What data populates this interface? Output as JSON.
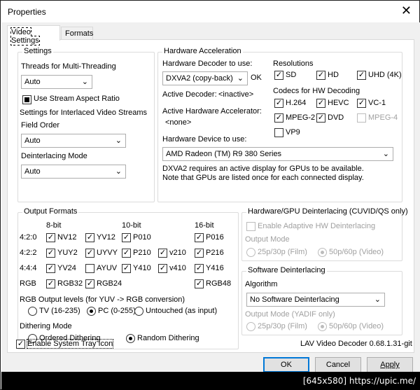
{
  "window": {
    "title": "Properties"
  },
  "tabs": [
    "Video Settings",
    "Formats"
  ],
  "settings": {
    "group_label": "Settings",
    "threads_label": "Threads for Multi-Threading",
    "threads_value": "Auto",
    "stream_aspect_label": "Use Stream Aspect Ratio",
    "interlaced_label": "Settings for Interlaced Video Streams",
    "field_order_label": "Field Order",
    "field_order_value": "Auto",
    "deint_mode_label": "Deinterlacing Mode",
    "deint_mode_value": "Auto"
  },
  "hwaccel": {
    "group_label": "Hardware Acceleration",
    "decoder_label": "Hardware Decoder to use:",
    "decoder_value": "DXVA2 (copy-back)",
    "ok_status": "OK",
    "active_decoder_label": "Active Decoder:",
    "active_decoder_value": "<inactive>",
    "active_accel_label": "Active Hardware Accelerator:",
    "active_accel_value": "<none>",
    "device_label": "Hardware Device to use:",
    "device_value": "AMD Radeon (TM) R9 380 Series",
    "note_line1": "DXVA2 requires an active display for GPUs to be available.",
    "note_line2": "Note that GPUs are listed once for each connected display.",
    "resolutions_label": "Resolutions",
    "res": [
      "SD",
      "HD",
      "UHD (4K)"
    ],
    "codecs_label": "Codecs for HW Decoding",
    "codecs": [
      "H.264",
      "HEVC",
      "VC-1",
      "MPEG-2",
      "DVD",
      "MPEG-4",
      "VP9"
    ]
  },
  "output": {
    "group_label": "Output Formats",
    "bit8": "8-bit",
    "bit10": "10-bit",
    "bit16": "16-bit",
    "rows": [
      "4:2:0",
      "4:2:2",
      "4:4:4",
      "RGB"
    ],
    "fmt": {
      "nv12": "NV12",
      "yv12": "YV12",
      "p010": "P010",
      "p016": "P016",
      "yuy2": "YUY2",
      "uyvy": "UYVY",
      "p210": "P210",
      "v210": "v210",
      "p216": "P216",
      "yv24": "YV24",
      "ayuv": "AYUV",
      "y410": "Y410",
      "v410": "v410",
      "y416": "Y416",
      "rgb32": "RGB32",
      "rgb24": "RGB24",
      "rgb48": "RGB48"
    },
    "levels_label": "RGB Output levels (for YUV -> RGB conversion)",
    "levels": [
      "TV (16-235)",
      "PC (0-255)",
      "Untouched (as input)"
    ],
    "dither_label": "Dithering Mode",
    "dither": [
      "Ordered Dithering",
      "Random Dithering"
    ]
  },
  "hwdeint": {
    "group_label": "Hardware/GPU Deinterlacing (CUVID/QS only)",
    "adaptive_label": "Enable Adaptive HW Deinterlacing",
    "output_mode_label": "Output Mode",
    "modes": [
      "25p/30p (Film)",
      "50p/60p (Video)"
    ]
  },
  "swdeint": {
    "group_label": "Software Deinterlacing",
    "algorithm_label": "Algorithm",
    "algorithm_value": "No Software Deinterlacing",
    "output_mode_label": "Output Mode (YADIF only)",
    "modes": [
      "25p/30p (Film)",
      "50p/60p (Video)"
    ]
  },
  "tray_label": "Enable System Tray Icon",
  "version": "LAV Video Decoder 0.68.1.31-git",
  "buttons": {
    "ok": "OK",
    "cancel": "Cancel",
    "apply": "Apply"
  },
  "watermark": "[645x580] https://upic.me/"
}
